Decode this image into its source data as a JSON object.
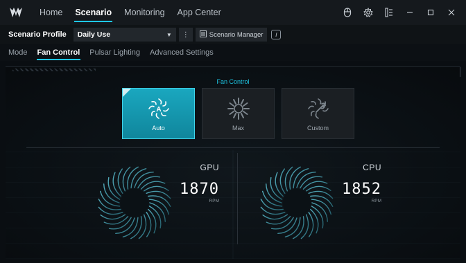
{
  "nav": {
    "tabs": [
      {
        "label": "Home"
      },
      {
        "label": "Scenario"
      },
      {
        "label": "Monitoring"
      },
      {
        "label": "App Center"
      }
    ],
    "active": "Scenario"
  },
  "profile": {
    "label": "Scenario Profile",
    "selected": "Daily Use",
    "manager_label": "Scenario Manager"
  },
  "subtabs": [
    "Mode",
    "Fan Control",
    "Pulsar Lighting",
    "Advanced Settings"
  ],
  "fan_control": {
    "title": "Fan Control",
    "modes": [
      {
        "label": "Auto",
        "active": true
      },
      {
        "label": "Max",
        "active": false
      },
      {
        "label": "Custom",
        "active": false
      }
    ],
    "gpu": {
      "name": "GPU",
      "rpm": "1870",
      "unit": "RPM"
    },
    "cpu": {
      "name": "CPU",
      "rpm": "1852",
      "unit": "RPM"
    }
  },
  "colors": {
    "accent": "#1ec8e6",
    "active_mode": "#1aa7bf"
  }
}
